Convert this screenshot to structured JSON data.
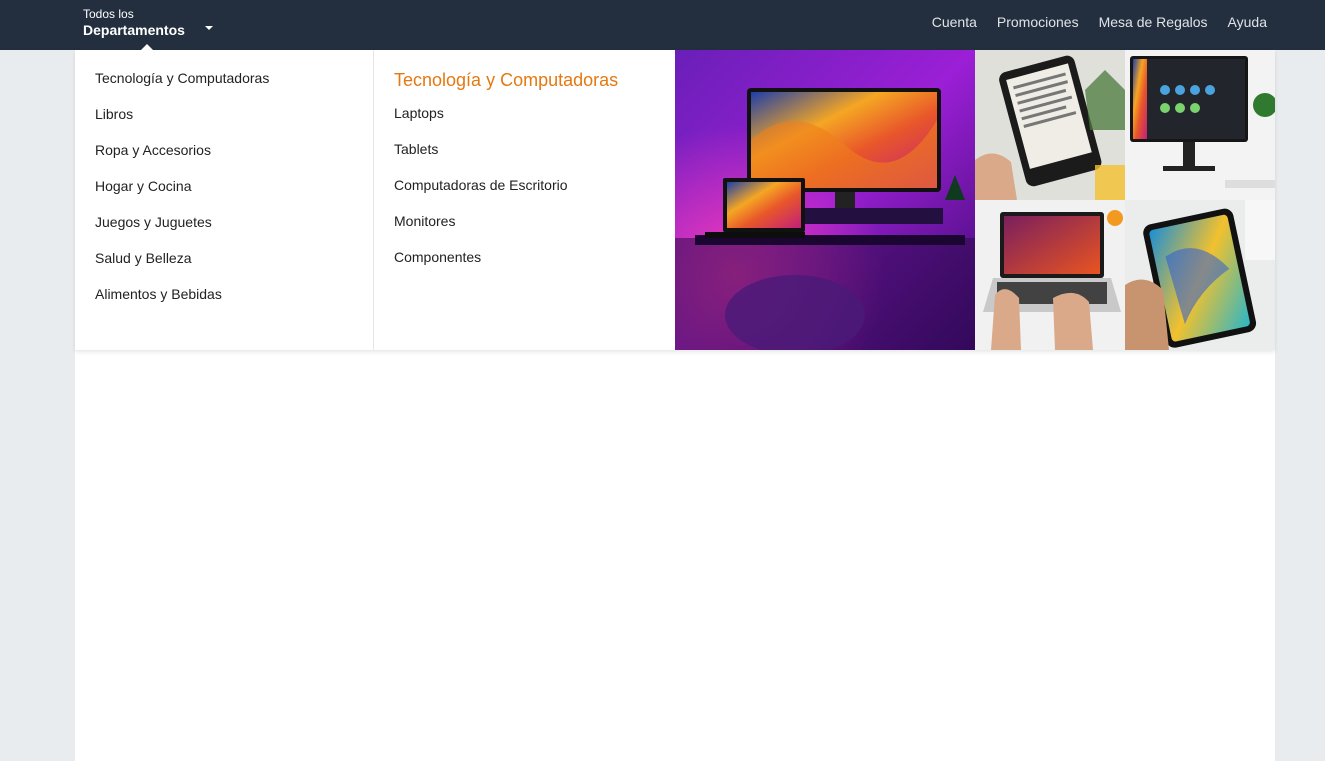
{
  "header": {
    "dept_small": "Todos los",
    "dept_big": "Departamentos",
    "nav": [
      "Cuenta",
      "Promociones",
      "Mesa de Regalos",
      "Ayuda"
    ]
  },
  "menu": {
    "categories": [
      "Tecnología y Computadoras",
      "Libros",
      "Ropa y Accesorios",
      "Hogar y Cocina",
      "Juegos y Juguetes",
      "Salud y Belleza",
      "Alimentos y Bebidas"
    ],
    "active_title": "Tecnología y Computadoras",
    "subcategories": [
      "Laptops",
      "Tablets",
      "Computadoras de Escritorio",
      "Monitores",
      "Componentes"
    ]
  },
  "colors": {
    "topbar": "#232f3e",
    "accent_orange": "#e47911",
    "page_bg": "#e9ecee"
  }
}
